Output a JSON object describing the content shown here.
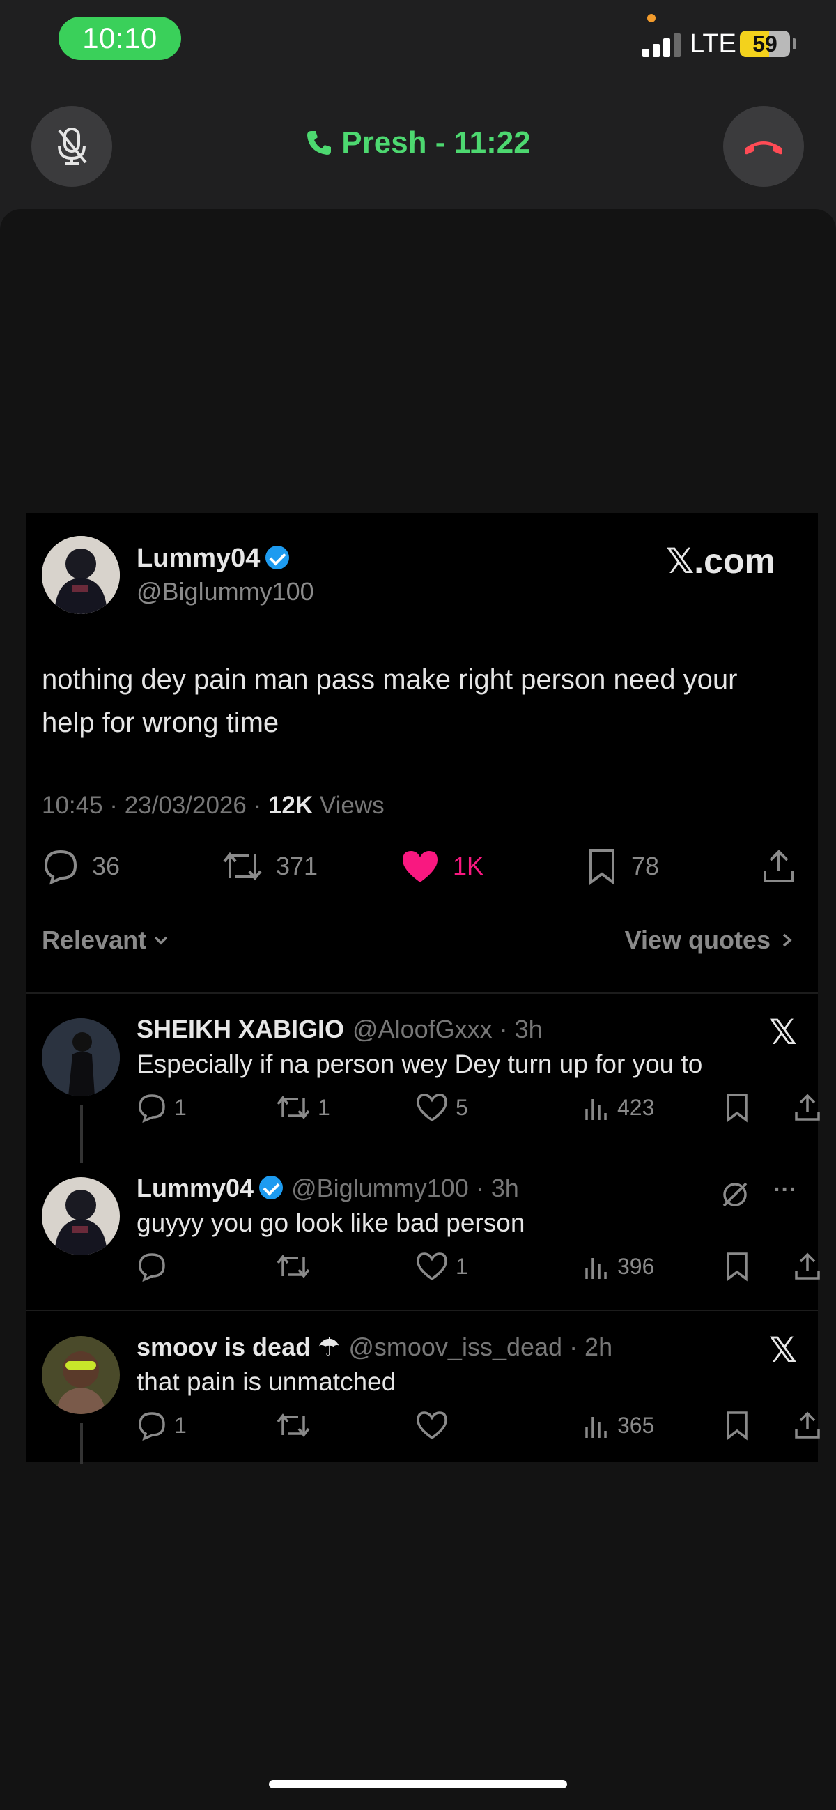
{
  "status_bar": {
    "time": "10:10",
    "network": "LTE",
    "battery_level": "59",
    "battery_fraction": 0.59,
    "signal_bars_active": 3
  },
  "call": {
    "caller": "Presh - 11:22",
    "mute_icon": "mic-off-icon",
    "end_icon": "phone-hangup-icon",
    "accent_color": "#4dd870",
    "end_color": "#ff4b55"
  },
  "tweet": {
    "name": "Lummy04",
    "handle": "@Biglummy100",
    "source": "𝕏.com",
    "text": "nothing dey pain man pass make right person need your help  for wrong time",
    "time": "10:45 · 23/03/2026 · ",
    "views_count": "12K",
    "views_label": " Views",
    "replies": "36",
    "retweets": "371",
    "likes": "1K",
    "bookmarks": "78",
    "like_color": "#f91880"
  },
  "filters": {
    "sort": "Relevant",
    "view_quotes": "View quotes"
  },
  "replies": [
    {
      "name": "SHEIKH XABIGIO",
      "handle": "@AloofGxxx · 3h",
      "text": "Especially if na person wey Dey turn up for you to",
      "replies": "1",
      "retweets": "1",
      "likes": "5",
      "views": "423",
      "badge": "𝕏"
    },
    {
      "name": "Lummy04",
      "handle": "@Biglummy100 · 3h",
      "text": "guyyy you go look like bad person",
      "replies": "",
      "retweets": "",
      "likes": "1",
      "views": "396",
      "badge": "···"
    },
    {
      "name": "smoov is dead ☂",
      "handle": "@smoov_iss_dead · 2h",
      "text": "that pain is unmatched",
      "replies": "1",
      "retweets": "",
      "likes": "",
      "views": "365",
      "badge": "𝕏"
    }
  ]
}
